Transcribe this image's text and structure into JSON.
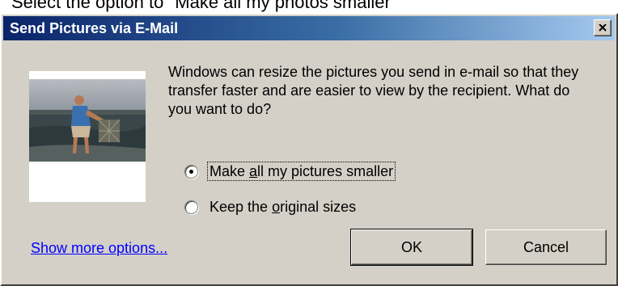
{
  "instruction": {
    "text": "Select the option to \"Make all my photos smaller\""
  },
  "dialog": {
    "title": "Send Pictures via E-Mail",
    "close_icon": "close-icon",
    "message": "Windows can resize the pictures you send in e-mail so that they transfer faster and are easier to view by the recipient.  What do you want to do?",
    "options": [
      {
        "label_pre": "Make ",
        "label_key": "a",
        "label_post": "ll my pictures smaller",
        "selected": true
      },
      {
        "label_pre": "Keep the ",
        "label_key": "o",
        "label_post": "riginal sizes",
        "selected": false
      }
    ],
    "more_options_link": "Show more options...",
    "ok_label": "OK",
    "cancel_label": "Cancel"
  },
  "colors": {
    "face": "#d4d0c8",
    "title_start": "#0a246a",
    "title_end": "#a6caf0",
    "link": "#0000ff"
  }
}
